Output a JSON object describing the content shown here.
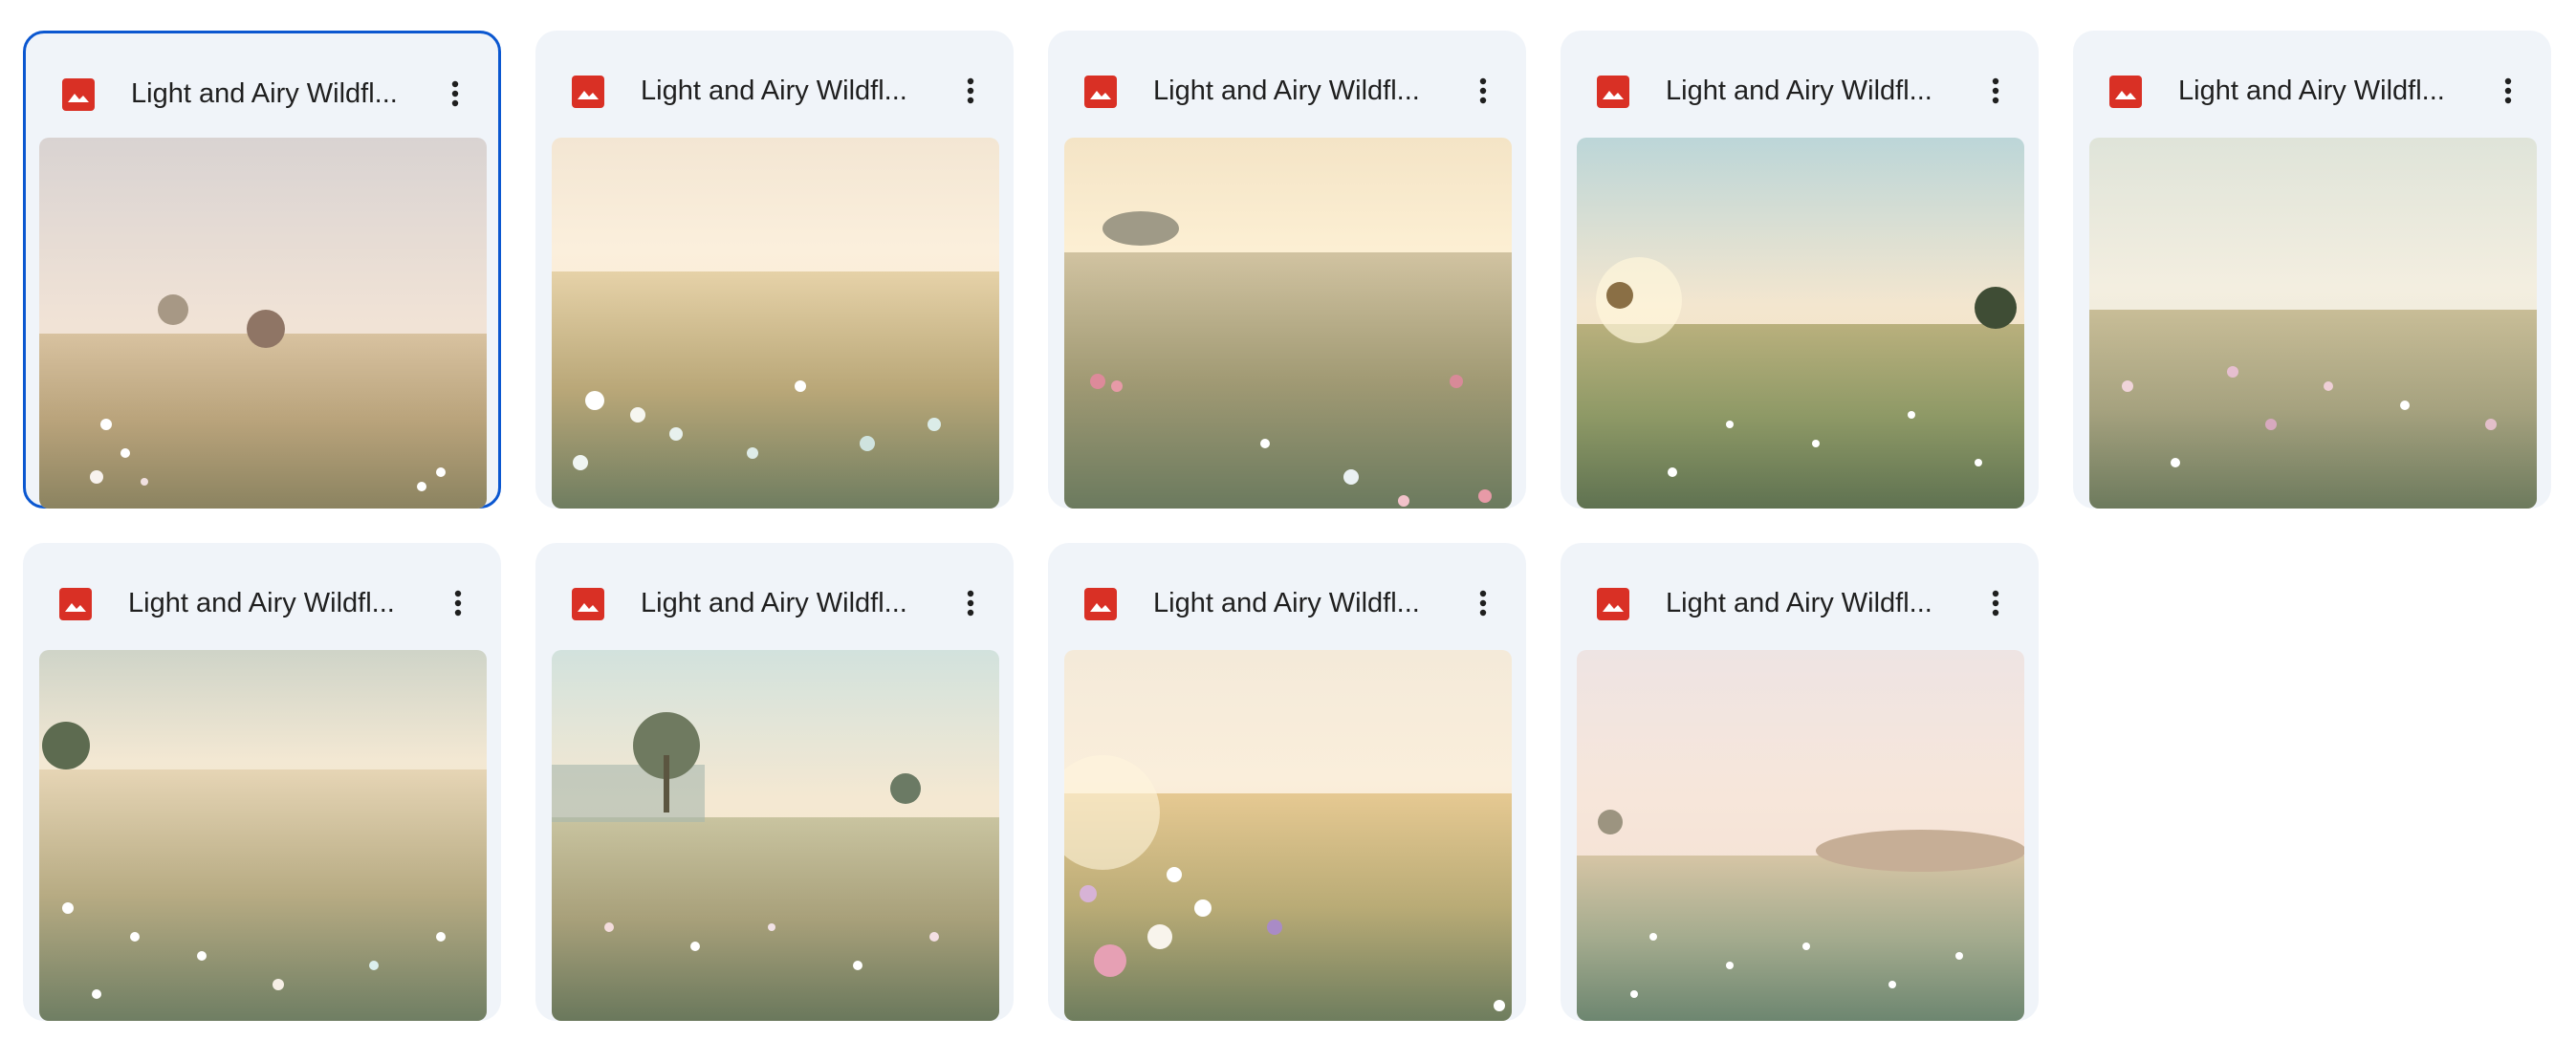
{
  "files": [
    {
      "name": "Light and Airy Wildfl...",
      "selected": true,
      "icon": "image-file-icon",
      "menu_icon": "more-vert-icon"
    },
    {
      "name": "Light and Airy Wildfl...",
      "selected": false,
      "icon": "image-file-icon",
      "menu_icon": "more-vert-icon"
    },
    {
      "name": "Light and Airy Wildfl...",
      "selected": false,
      "icon": "image-file-icon",
      "menu_icon": "more-vert-icon"
    },
    {
      "name": "Light and Airy Wildfl...",
      "selected": false,
      "icon": "image-file-icon",
      "menu_icon": "more-vert-icon"
    },
    {
      "name": "Light and Airy Wildfl...",
      "selected": false,
      "icon": "image-file-icon",
      "menu_icon": "more-vert-icon"
    },
    {
      "name": "Light and Airy Wildfl...",
      "selected": false,
      "icon": "image-file-icon",
      "menu_icon": "more-vert-icon"
    },
    {
      "name": "Light and Airy Wildfl...",
      "selected": false,
      "icon": "image-file-icon",
      "menu_icon": "more-vert-icon"
    },
    {
      "name": "Light and Airy Wildfl...",
      "selected": false,
      "icon": "image-file-icon",
      "menu_icon": "more-vert-icon"
    },
    {
      "name": "Light and Airy Wildfl...",
      "selected": false,
      "icon": "image-file-icon",
      "menu_icon": "more-vert-icon"
    }
  ],
  "colors": {
    "card_background": "#f0f4f9",
    "selected_border": "#0b57d0",
    "image_icon": "#d93025",
    "text": "#1f1f1f"
  }
}
